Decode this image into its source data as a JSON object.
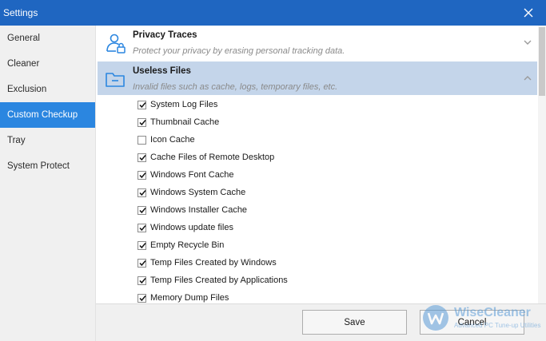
{
  "window": {
    "title": "Settings"
  },
  "sidebar": {
    "items": [
      {
        "label": "General",
        "active": false
      },
      {
        "label": "Cleaner",
        "active": false
      },
      {
        "label": "Exclusion",
        "active": false
      },
      {
        "label": "Custom Checkup",
        "active": true
      },
      {
        "label": "Tray",
        "active": false
      },
      {
        "label": "System Protect",
        "active": false
      }
    ]
  },
  "sections": [
    {
      "title": "Privacy Traces",
      "description": "Protect your privacy by erasing personal tracking data.",
      "icon": "user-lock-icon",
      "expanded": false
    },
    {
      "title": "Useless Files",
      "description": "Invalid files such as cache, logs, temporary files, etc.",
      "icon": "folder-icon",
      "expanded": true
    }
  ],
  "useless_files_items": [
    {
      "label": "System Log Files",
      "checked": true
    },
    {
      "label": "Thumbnail Cache",
      "checked": true
    },
    {
      "label": "Icon Cache",
      "checked": false
    },
    {
      "label": "Cache Files of Remote Desktop",
      "checked": true
    },
    {
      "label": "Windows Font Cache",
      "checked": true
    },
    {
      "label": "Windows System Cache",
      "checked": true
    },
    {
      "label": "Windows Installer Cache",
      "checked": true
    },
    {
      "label": "Windows update files",
      "checked": true
    },
    {
      "label": "Empty Recycle Bin",
      "checked": true
    },
    {
      "label": "Temp Files Created by Windows",
      "checked": true
    },
    {
      "label": "Temp Files Created by Applications",
      "checked": true
    },
    {
      "label": "Memory Dump Files",
      "checked": true
    }
  ],
  "footer": {
    "save_label": "Save",
    "cancel_label": "Cancel"
  },
  "watermark": {
    "name": "WiseCleaner",
    "tagline": "Advanced PC Tune-up Utilities"
  },
  "colors": {
    "titlebar": "#1f66c1",
    "active_nav": "#2b86e0",
    "expanded_section": "#c4d5ea"
  }
}
